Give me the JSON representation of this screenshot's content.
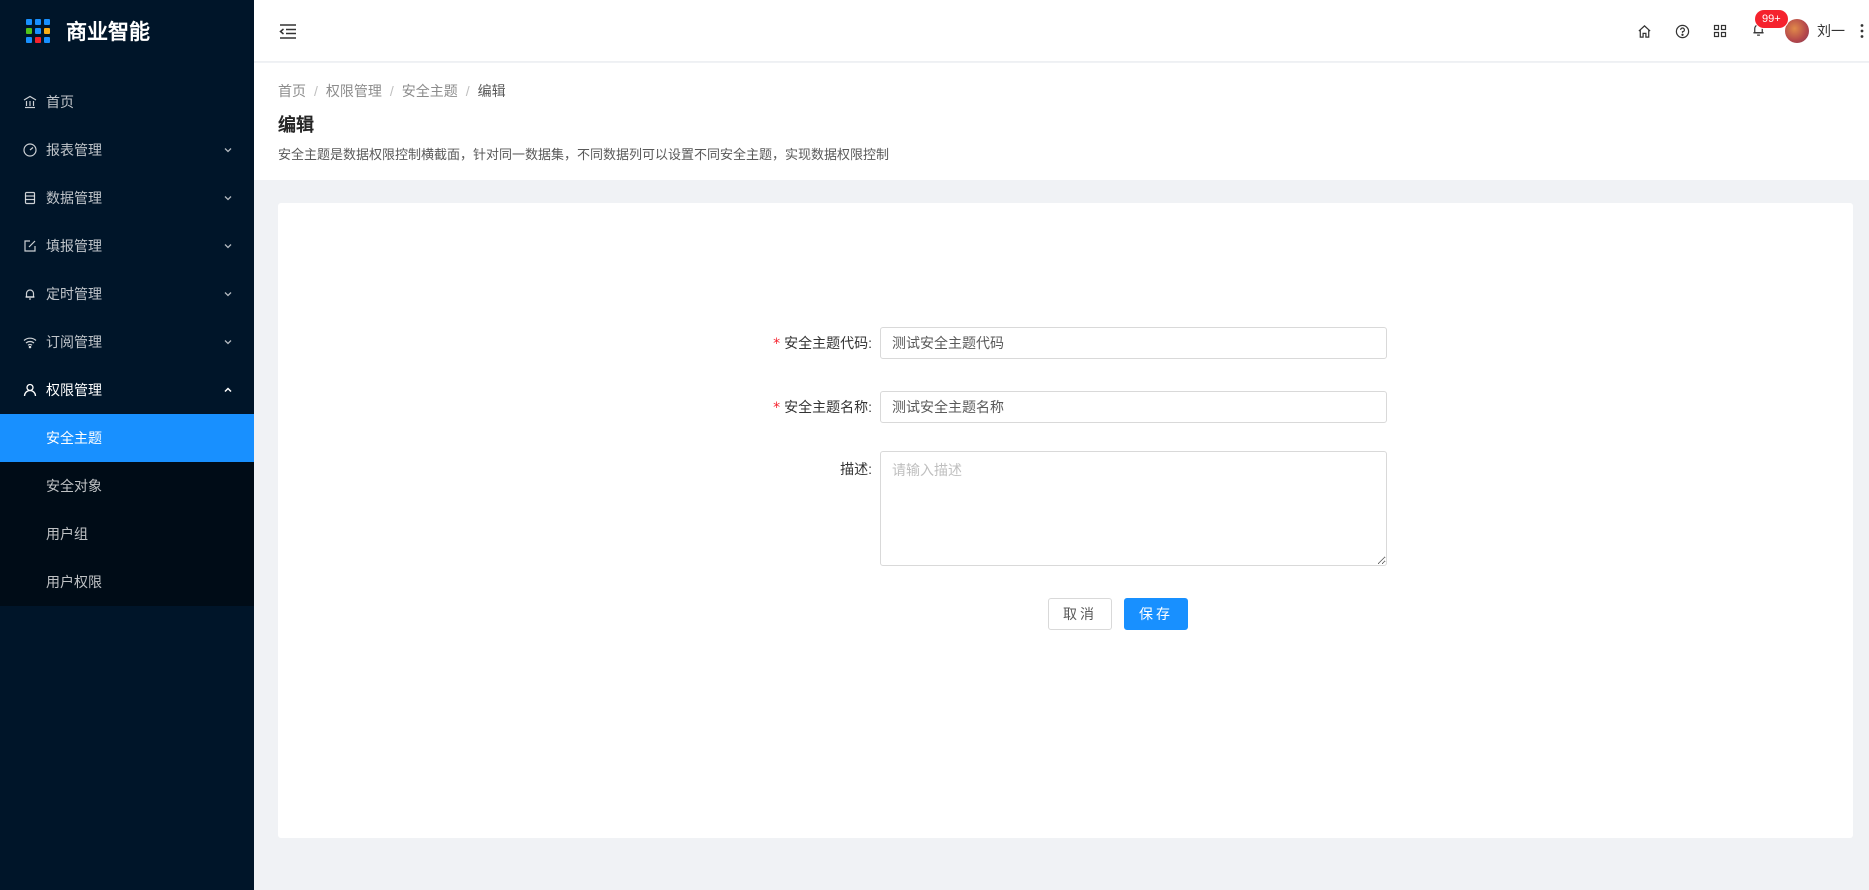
{
  "app": {
    "title": "商业智能",
    "logo_colors": [
      "#1890ff",
      "#1890ff",
      "#1890ff",
      "#52c41a",
      "#1890ff",
      "#faad14",
      "#1890ff",
      "#f5222d",
      "#1890ff"
    ]
  },
  "sidebar": {
    "items": [
      {
        "label": "首页",
        "icon": "bank-icon"
      },
      {
        "label": "报表管理",
        "icon": "dashboard-icon"
      },
      {
        "label": "数据管理",
        "icon": "database-icon"
      },
      {
        "label": "填报管理",
        "icon": "edit-icon"
      },
      {
        "label": "定时管理",
        "icon": "bell-icon"
      },
      {
        "label": "订阅管理",
        "icon": "wifi-icon"
      },
      {
        "label": "权限管理",
        "icon": "user-icon"
      }
    ],
    "submenu": [
      {
        "label": "安全主题",
        "active": true
      },
      {
        "label": "安全对象"
      },
      {
        "label": "用户组"
      },
      {
        "label": "用户权限"
      }
    ]
  },
  "header": {
    "notification_count": "99+",
    "username": "刘一"
  },
  "breadcrumb": {
    "items": [
      "首页",
      "权限管理",
      "安全主题",
      "编辑"
    ],
    "separator": "/"
  },
  "page": {
    "title": "编辑",
    "description": "安全主题是数据权限控制横截面，针对同一数据集，不同数据列可以设置不同安全主题，实现数据权限控制"
  },
  "form": {
    "code": {
      "required_mark": "*",
      "label": "安全主题代码:",
      "value": "测试安全主题代码"
    },
    "name": {
      "required_mark": "*",
      "label": "安全主题名称:",
      "value": "测试安全主题名称"
    },
    "description": {
      "label": "描述:",
      "value": "",
      "placeholder": "请输入描述"
    },
    "cancel_label": "取消",
    "save_label": "保存"
  },
  "colors": {
    "sidebar_bg": "#001529",
    "submenu_bg": "#000c17",
    "accent": "#1890ff",
    "badge": "#f5222d"
  }
}
